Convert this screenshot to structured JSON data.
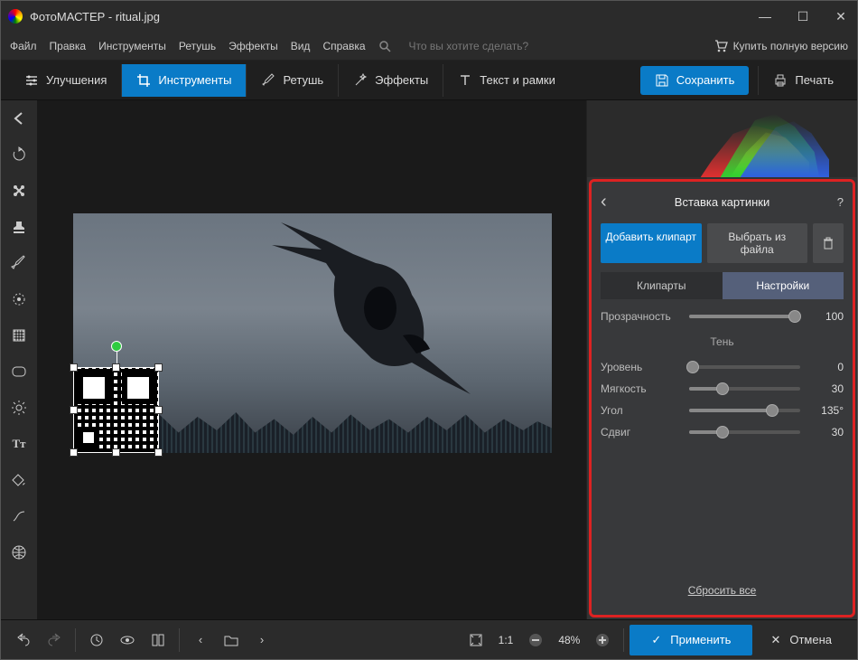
{
  "titlebar": {
    "title": "ФотоМАСТЕР - ritual.jpg"
  },
  "menu": {
    "file": "Файл",
    "edit": "Правка",
    "tools": "Инструменты",
    "retouch": "Ретушь",
    "effects": "Эффекты",
    "view": "Вид",
    "help": "Справка",
    "search_placeholder": "Что вы хотите сделать?",
    "buy_full": "Купить полную версию"
  },
  "toolbar": {
    "improve": "Улучшения",
    "tools": "Инструменты",
    "retouch": "Ретушь",
    "effects": "Эффекты",
    "textframes": "Текст и рамки",
    "save": "Сохранить",
    "print": "Печать"
  },
  "rightpanel": {
    "title": "Вставка картинки",
    "add_clipart": "Добавить клипарт",
    "from_file": "Выбрать из файла",
    "tab_cliparts": "Клипарты",
    "tab_settings": "Настройки",
    "opacity_lbl": "Прозрачность",
    "opacity_val": "100",
    "shadow_header": "Тень",
    "level_lbl": "Уровень",
    "level_val": "0",
    "soft_lbl": "Мягкость",
    "soft_val": "30",
    "angle_lbl": "Угол",
    "angle_val": "135°",
    "shift_lbl": "Сдвиг",
    "shift_val": "30",
    "reset_all": "Сбросить все"
  },
  "bottombar": {
    "ratio11": "1:1",
    "zoom": "48%",
    "apply": "Применить",
    "cancel": "Отмена"
  },
  "sliders": {
    "opacity_pct": 95,
    "level_pct": 3,
    "soft_pct": 30,
    "angle_pct": 75,
    "shift_pct": 30
  }
}
